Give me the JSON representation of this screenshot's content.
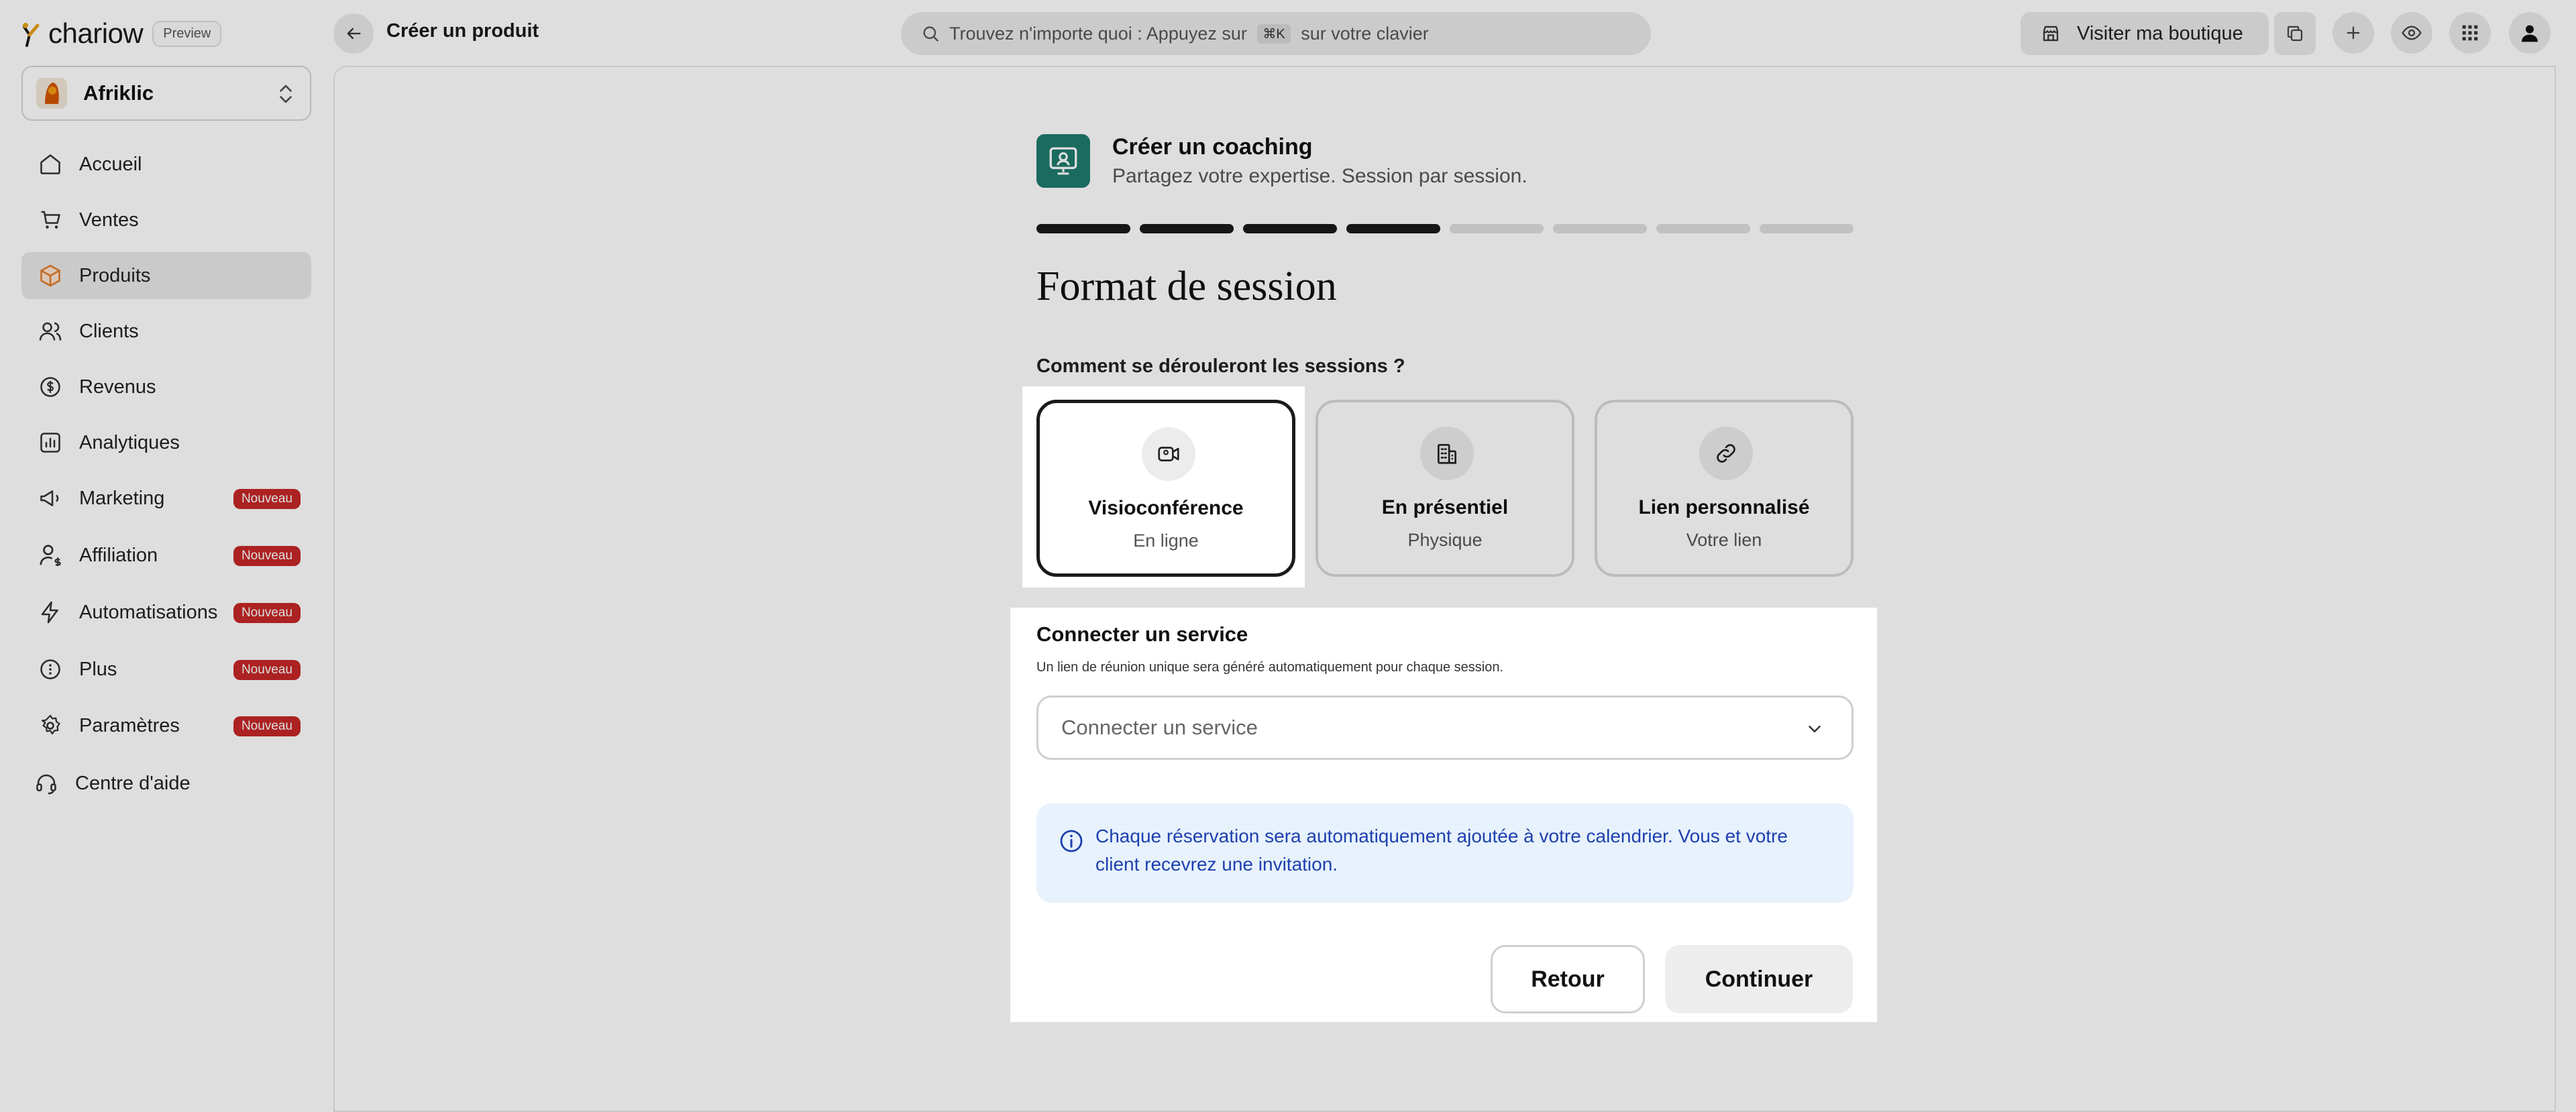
{
  "app": {
    "logo_text": "chariow",
    "preview_badge": "Preview"
  },
  "header": {
    "breadcrumb": "Créer un produit",
    "search": {
      "prefix": "Trouvez n'importe quoi : Appuyez sur ",
      "shortcut": "⌘K",
      "suffix": " sur votre clavier"
    },
    "visit_store": "Visiter ma boutique"
  },
  "sidebar": {
    "store_name": "Afriklic",
    "items": [
      {
        "label": "Accueil",
        "icon": "home-icon",
        "badge": ""
      },
      {
        "label": "Ventes",
        "icon": "cart-icon",
        "badge": ""
      },
      {
        "label": "Produits",
        "icon": "box-icon",
        "badge": "",
        "active": true
      },
      {
        "label": "Clients",
        "icon": "users-icon",
        "badge": ""
      },
      {
        "label": "Revenus",
        "icon": "coins-icon",
        "badge": ""
      },
      {
        "label": "Analytiques",
        "icon": "chart-icon",
        "badge": ""
      },
      {
        "label": "Marketing",
        "icon": "megaphone-icon",
        "badge": "Nouveau"
      },
      {
        "label": "Affiliation",
        "icon": "user-dollar-icon",
        "badge": "Nouveau"
      },
      {
        "label": "Automatisations",
        "icon": "bolt-icon",
        "badge": "Nouveau"
      },
      {
        "label": "Plus",
        "icon": "more-icon",
        "badge": "Nouveau"
      },
      {
        "label": "Paramètres",
        "icon": "gear-icon",
        "badge": "Nouveau"
      },
      {
        "label": "Centre d'aide",
        "icon": "headset-icon",
        "badge": ""
      }
    ]
  },
  "wizard": {
    "title": "Créer un coaching",
    "subtitle": "Partagez votre expertise. Session par session.",
    "steps_total": 8,
    "steps_done": 4,
    "page_title": "Format de session",
    "question": "Comment se dérouleront les sessions ?",
    "options": [
      {
        "title": "Visioconférence",
        "subtitle": "En ligne",
        "icon": "video-icon",
        "selected": true
      },
      {
        "title": "En présentiel",
        "subtitle": "Physique",
        "icon": "building-icon",
        "selected": false
      },
      {
        "title": "Lien personnalisé",
        "subtitle": "Votre lien",
        "icon": "link-icon",
        "selected": false
      }
    ],
    "service": {
      "title": "Connecter un service",
      "description": "Un lien de réunion unique sera généré automatiquement pour chaque session.",
      "placeholder": "Connecter un service"
    },
    "info": "Chaque réservation sera automatiquement ajoutée à votre calendrier. Vous et votre client recevrez une invitation.",
    "back_label": "Retour",
    "continue_label": "Continuer"
  },
  "colors": {
    "accent_teal": "#1f7b6e",
    "badge_red": "#c62828",
    "info_bg": "#e7f2fc",
    "info_text": "#1e40af"
  }
}
